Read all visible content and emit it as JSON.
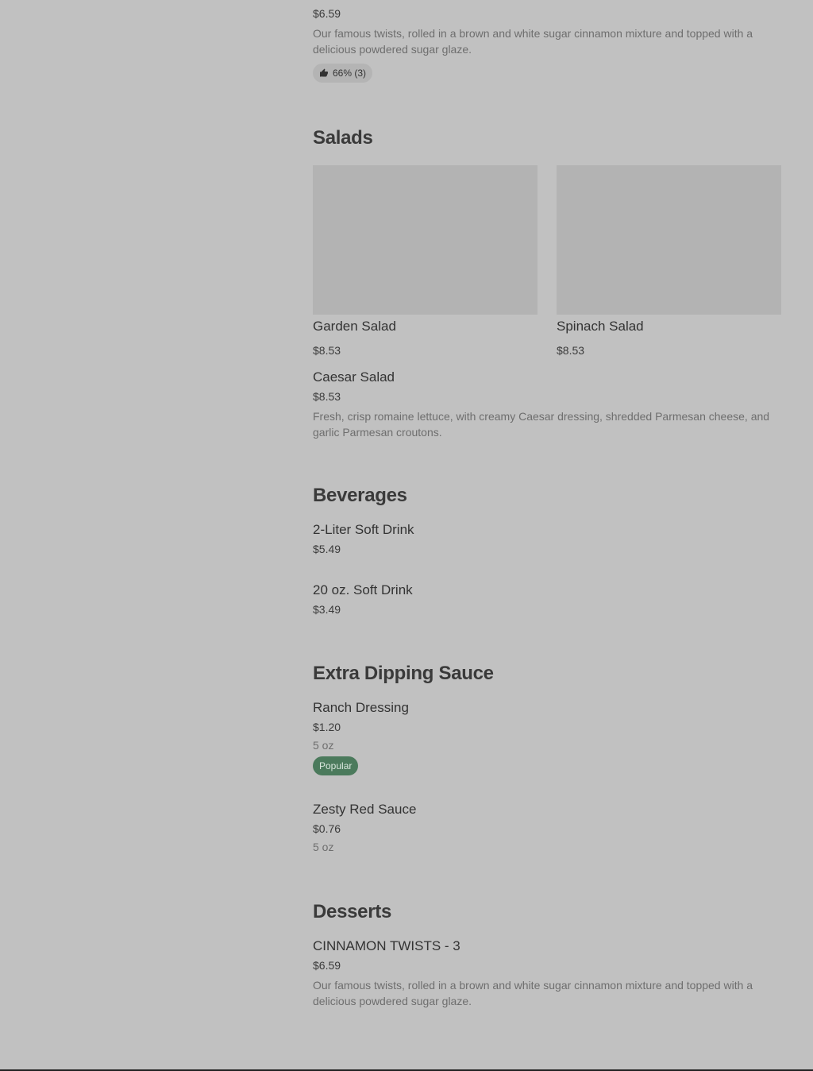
{
  "top_item": {
    "price": "$6.59",
    "description": "Our famous twists, rolled in a brown and white sugar cinnamon mixture and topped with a delicious powdered sugar glaze.",
    "rating": "66% (3)"
  },
  "salads": {
    "title": "Salads",
    "cards": [
      {
        "name": "Garden Salad",
        "price": "$8.53"
      },
      {
        "name": "Spinach Salad",
        "price": "$8.53"
      }
    ],
    "caesar": {
      "name": "Caesar Salad",
      "price": "$8.53",
      "description": "Fresh, crisp romaine lettuce, with creamy Caesar dressing, shredded Parmesan cheese, and garlic Parmesan croutons."
    }
  },
  "beverages": {
    "title": "Beverages",
    "items": [
      {
        "name": "2-Liter Soft Drink",
        "price": "$5.49"
      },
      {
        "name": "20 oz. Soft Drink",
        "price": "$3.49"
      }
    ]
  },
  "sauce": {
    "title": "Extra Dipping Sauce",
    "items": [
      {
        "name": "Ranch Dressing",
        "price": "$1.20",
        "size": "5 oz",
        "badge": "Popular"
      },
      {
        "name": "Zesty Red Sauce",
        "price": "$0.76",
        "size": "5 oz"
      }
    ]
  },
  "desserts": {
    "title": "Desserts",
    "items": [
      {
        "name": "CINNAMON TWISTS - 3",
        "price": "$6.59",
        "description": "Our famous twists, rolled in a brown and white sugar cinnamon mixture and topped with a delicious powdered sugar glaze."
      }
    ]
  },
  "colors": {
    "overlay_background": "#c1c1c1",
    "badge_green": "#4b7a5c"
  },
  "icons": {
    "rating": "thumbs-up-icon"
  }
}
